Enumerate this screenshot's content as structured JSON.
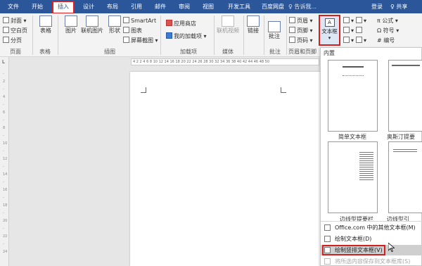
{
  "tabs": [
    {
      "label": "文件"
    },
    {
      "label": "开始"
    },
    {
      "label": "插入"
    },
    {
      "label": "设计"
    },
    {
      "label": "布局"
    },
    {
      "label": "引用"
    },
    {
      "label": "邮件"
    },
    {
      "label": "审阅"
    },
    {
      "label": "视图"
    },
    {
      "label": "开发工具"
    },
    {
      "label": "百度网盘"
    }
  ],
  "search_placeholder": "♀ 告诉我...",
  "login": "登录",
  "share": "♀ 共享",
  "ribbon": {
    "pages": {
      "cover": "封面",
      "blank": "空白页",
      "break": "分页",
      "group": "页面"
    },
    "table": {
      "label": "表格",
      "group": "表格"
    },
    "illustrations": {
      "picture": "图片",
      "online_picture": "联机图片",
      "shapes": "形状",
      "smartart": "SmartArt",
      "chart": "图表",
      "screenshot": "屏幕截图",
      "group": "插图"
    },
    "addins": {
      "store": "应用商店",
      "my_addins": "我的加载项",
      "group": "加载项"
    },
    "media": {
      "online_video": "联机视频",
      "group": "媒体"
    },
    "links": {
      "label": "链接"
    },
    "comments": {
      "label": "批注",
      "group": "批注"
    },
    "header_footer": {
      "header": "页眉",
      "footer": "页脚",
      "page_number": "页码",
      "group": "页眉和页脚"
    },
    "text": {
      "textbox": "文本框",
      "group": "内置"
    },
    "symbols": {
      "equation": "公式",
      "symbol": "符号",
      "number": "编号"
    }
  },
  "ruler_h": "4 2 2 4 6 8 10 12 14 16 18 20 22 24 26 28 30 32 34 36 38 40 42 44 46 48 50",
  "ruler_v": [
    "-",
    "2",
    "-",
    "4",
    "-",
    "6",
    "-",
    "8",
    "-",
    "10",
    "-",
    "12",
    "-",
    "14",
    "-",
    "16",
    "-",
    "18",
    "-",
    "20",
    "-",
    "22",
    "-",
    "24"
  ],
  "dropdown": {
    "header": "内置",
    "thumbs": [
      {
        "label": "简单文本框"
      },
      {
        "label": "奥斯汀提要"
      },
      {
        "label": "边线型提要栏"
      },
      {
        "label": "边线型引"
      }
    ],
    "menu": [
      {
        "label": "Office.com 中的其他文本框(M)"
      },
      {
        "label": "绘制文本框(D)"
      },
      {
        "label": "绘制竖排文本框(V)"
      },
      {
        "label": "将所选内容保存到文本框库(S)"
      }
    ]
  },
  "colors": {
    "title_bar": "#2b579a",
    "highlight": "#d02020"
  }
}
